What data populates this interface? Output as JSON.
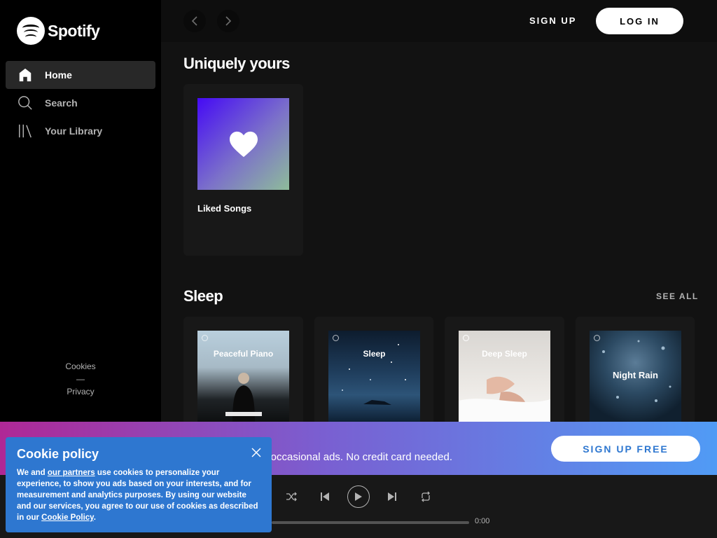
{
  "brand": {
    "name": "Spotify"
  },
  "sidebar": {
    "items": [
      {
        "label": "Home",
        "icon": "home-icon",
        "active": true
      },
      {
        "label": "Search",
        "icon": "search-icon",
        "active": false
      },
      {
        "label": "Your Library",
        "icon": "library-icon",
        "active": false
      }
    ],
    "footer": {
      "cookies": "Cookies",
      "divider": "—",
      "privacy": "Privacy"
    }
  },
  "topbar": {
    "signup": "SIGN UP",
    "login": "LOG IN"
  },
  "sections": {
    "uniquely": {
      "title": "Uniquely yours",
      "cards": [
        {
          "title": "Liked Songs",
          "icon": "heart-icon"
        }
      ]
    },
    "sleep": {
      "title": "Sleep",
      "see_all": "SEE ALL",
      "cards": [
        {
          "art_text": "Peaceful Piano"
        },
        {
          "art_text": "Sleep"
        },
        {
          "art_text": "Deep Sleep"
        },
        {
          "art_text": "Night Rain"
        }
      ]
    }
  },
  "banner": {
    "text": "th occasional ads. No credit card needed.",
    "button": "SIGN UP FREE"
  },
  "player": {
    "time": "0:00"
  },
  "cookie": {
    "title": "Cookie policy",
    "text_1": "We and ",
    "link_partners": "our partners",
    "text_2": " use cookies to personalize your experience, to show you ads based on your interests, and for measurement and analytics purposes. By using our website and our services, you agree to our use of cookies as described in our ",
    "link_policy": "Cookie Policy",
    "text_3": "."
  },
  "colors": {
    "accent_blue": "#2e77d0",
    "banner_start": "#af2896",
    "banner_end": "#509bf5"
  }
}
